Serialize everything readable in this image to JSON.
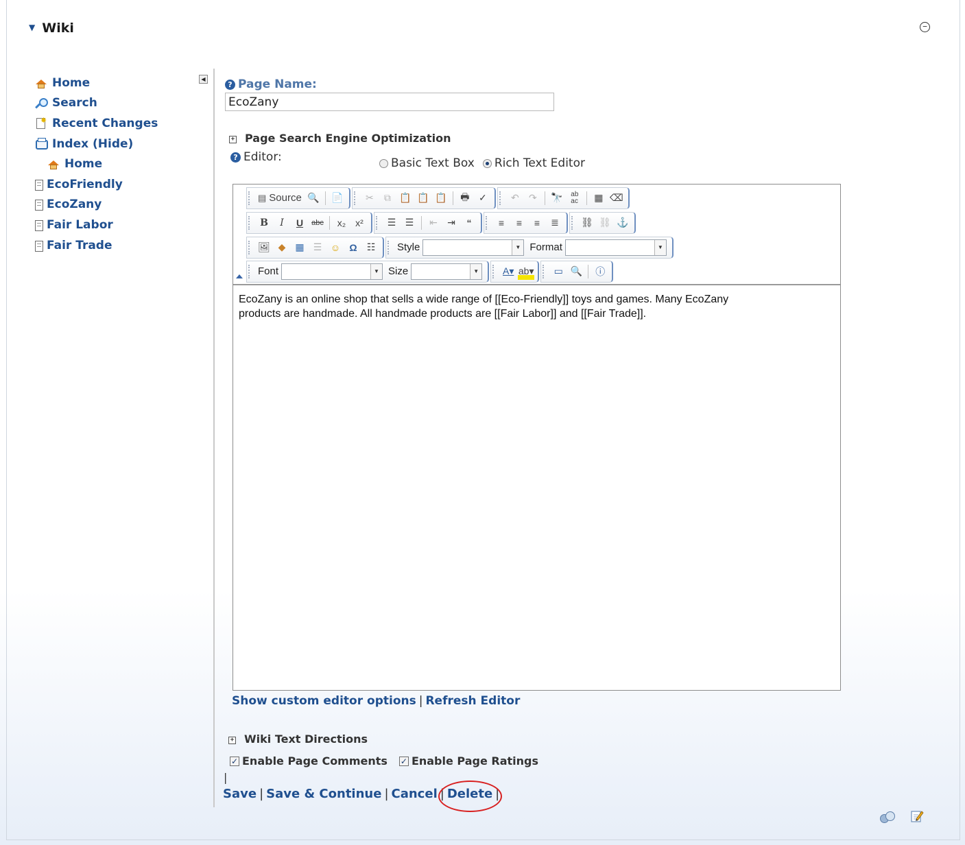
{
  "module": {
    "title": "Wiki",
    "minimize_glyph": "−"
  },
  "sidebar": {
    "items": [
      {
        "label": "Home",
        "icon": "home-icon"
      },
      {
        "label": "Search",
        "icon": "search-icon"
      },
      {
        "label": "Recent Changes",
        "icon": "recent-changes-icon"
      },
      {
        "label": "Index (Hide)",
        "icon": "index-icon"
      },
      {
        "label": "Home",
        "icon": "home-icon"
      },
      {
        "label": "EcoFriendly",
        "icon": "page-icon"
      },
      {
        "label": "EcoZany",
        "icon": "page-icon"
      },
      {
        "label": "Fair Labor",
        "icon": "page-icon"
      },
      {
        "label": "Fair Trade",
        "icon": "page-icon"
      }
    ]
  },
  "form": {
    "page_name_label": "Page Name:",
    "page_name_value": "EcoZany",
    "seo_label": "Page Search Engine Optimization",
    "editor_label": "Editor:",
    "editor_options": [
      {
        "label": "Basic Text Box",
        "selected": false
      },
      {
        "label": "Rich Text Editor",
        "selected": true
      }
    ]
  },
  "toolbar": {
    "source_label": "Source",
    "style_label": "Style",
    "format_label": "Format",
    "font_label": "Font",
    "size_label": "Size"
  },
  "editor_content": {
    "line1": "EcoZany is an online shop that sells a wide range of [[Eco-Friendly]] toys and games. Many EcoZany",
    "line2": "products are handmade. All handmade products are [[Fair Labor]] and [[Fair Trade]]."
  },
  "editor_links": {
    "show_options": "Show custom editor options",
    "separator": "|",
    "refresh": "Refresh Editor"
  },
  "wiki_text_directions": "Wiki Text Directions",
  "checkboxes": {
    "comments": {
      "label": "Enable Page Comments",
      "checked": true
    },
    "ratings": {
      "label": "Enable Page Ratings",
      "checked": true
    }
  },
  "actions": {
    "save": "Save",
    "save_continue": "Save & Continue",
    "cancel": "Cancel",
    "delete": "Delete",
    "separator": "|"
  },
  "colors": {
    "link": "#1f4f8f",
    "label": "#4f76a8",
    "highlight_ring": "#d82020"
  }
}
